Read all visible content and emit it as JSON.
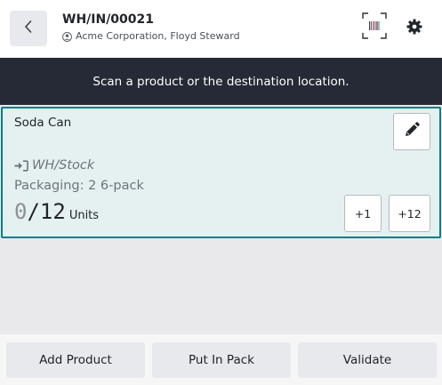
{
  "header": {
    "back_icon": "chevron-left-icon",
    "title": "WH/IN/00021",
    "subtitle": "Acme Corporation, Floyd Steward",
    "subtitle_icon": "user-circle-icon",
    "barcode_icon": "barcode-scan-icon",
    "settings_icon": "gear-icon"
  },
  "banner": {
    "message": "Scan a product or the destination location."
  },
  "line": {
    "product": "Soda Can",
    "edit_icon": "pencil-icon",
    "location_icon": "sign-in-icon",
    "location": "WH/Stock",
    "packaging": "Packaging: 2 6-pack",
    "qty_done": "0",
    "qty_total": "/12",
    "unit": "Units",
    "increment_one": "+1",
    "increment_all": "+12"
  },
  "footer": {
    "add_product": "Add Product",
    "put_in_pack": "Put In Pack",
    "validate": "Validate"
  },
  "colors": {
    "banner_bg": "#262a36",
    "card_bg": "#e5f0f0",
    "card_border": "#017e84",
    "page_bg": "#e9e9ec"
  }
}
